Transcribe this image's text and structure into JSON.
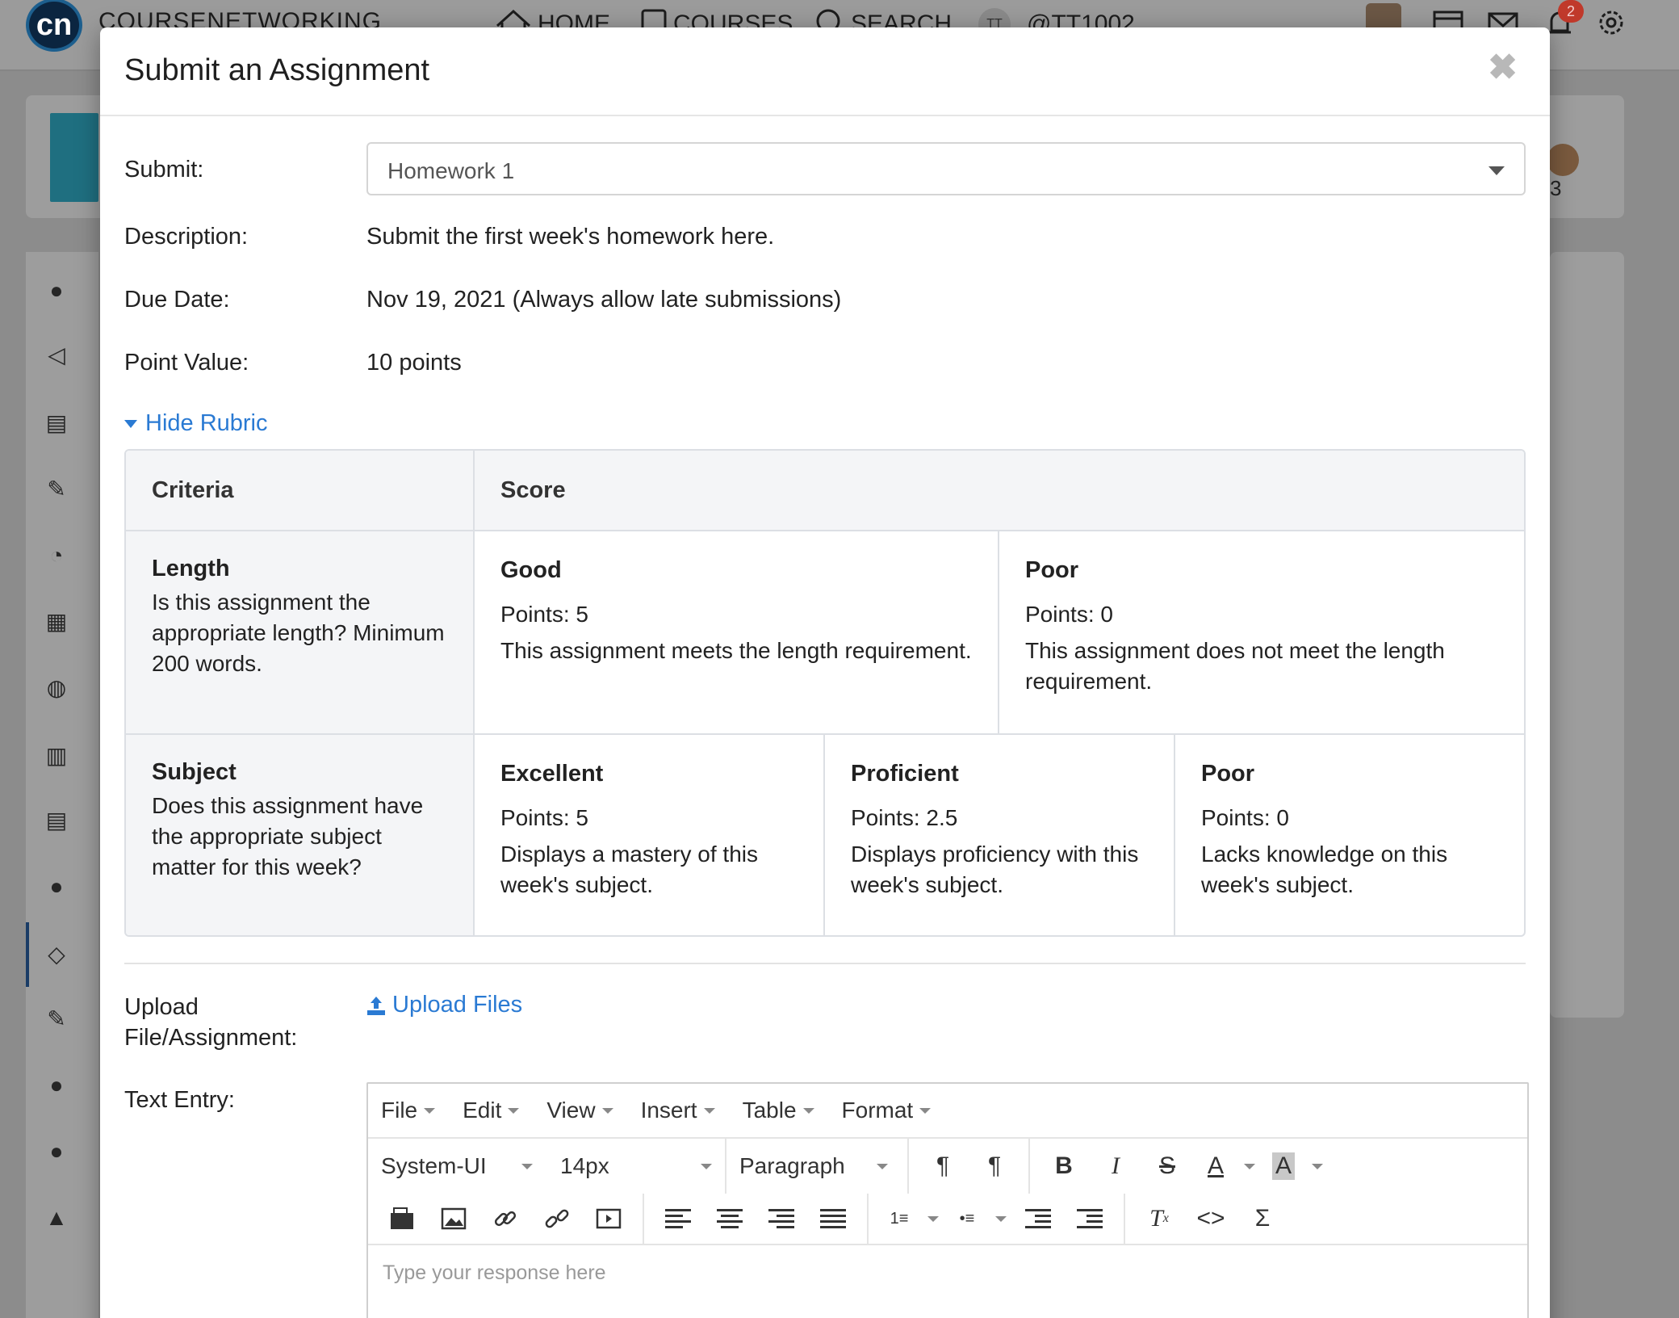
{
  "background": {
    "brand": "COURSENETWORKING",
    "logo_text": "cn",
    "nav": [
      {
        "label": "HOME",
        "icon": "home-icon"
      },
      {
        "label": "COURSES",
        "icon": "book-icon"
      },
      {
        "label": "SEARCH",
        "icon": "search-icon"
      },
      {
        "label": "@TT1002",
        "icon": "user-badge-icon",
        "badge": "TT"
      }
    ],
    "notification_count": "2",
    "member_count": "3"
  },
  "modal": {
    "title": "Submit an Assignment",
    "close_glyph": "✖",
    "submit_label": "Submit:",
    "submit_value": "Homework 1",
    "description_label": "Description:",
    "description_value": "Submit the first week's homework here.",
    "due_label": "Due Date:",
    "due_value": "Nov 19, 2021 (Always allow late submissions)",
    "points_label": "Point Value:",
    "points_value": "10 points",
    "rubric_toggle": "Hide Rubric",
    "upload_label": "Upload File/Assignment:",
    "upload_link": "Upload Files",
    "text_entry_label": "Text Entry:"
  },
  "rubric": {
    "headers": {
      "criteria": "Criteria",
      "score": "Score"
    },
    "rows": [
      {
        "title": "Length",
        "description": "Is this assignment the appropriate length? Minimum 200 words.",
        "levels": [
          {
            "name": "Good",
            "points": "Points: 5",
            "description": "This assignment meets the length requirement."
          },
          {
            "name": "Poor",
            "points": "Points: 0",
            "description": "This assignment does not meet the length requirement."
          }
        ]
      },
      {
        "title": "Subject",
        "description": "Does this assignment have the appropriate subject matter for this week?",
        "levels": [
          {
            "name": "Excellent",
            "points": "Points: 5",
            "description": "Displays a mastery of this week's subject."
          },
          {
            "name": "Proficient",
            "points": "Points: 2.5",
            "description": "Displays proficiency with this week's subject."
          },
          {
            "name": "Poor",
            "points": "Points: 0",
            "description": "Lacks knowledge on this week's subject."
          }
        ]
      }
    ]
  },
  "editor": {
    "menus": [
      "File",
      "Edit",
      "View",
      "Insert",
      "Table",
      "Format"
    ],
    "font_family": "System-UI",
    "font_size": "14px",
    "block_format": "Paragraph",
    "placeholder": "Type your response here"
  },
  "colors": {
    "accent": "#2a7ad3",
    "overlay": "#8c8c8c",
    "table_header_bg": "#f4f5f7",
    "notification": "#c0392b"
  }
}
